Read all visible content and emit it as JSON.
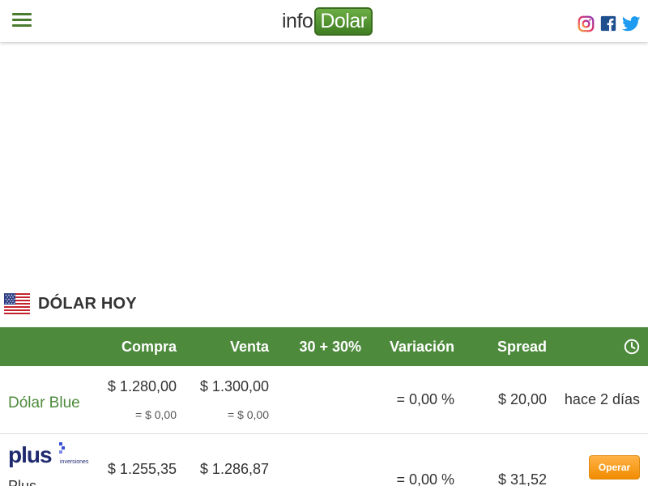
{
  "header": {
    "logo_prefix": "info",
    "logo_box": "Dolar",
    "social": [
      "instagram-icon",
      "facebook-icon",
      "twitter-icon"
    ]
  },
  "section": {
    "title": "DÓLAR HOY",
    "flag": "us-flag-icon"
  },
  "table": {
    "headers": {
      "compra": "Compra",
      "venta": "Venta",
      "tax": "30 + 30%",
      "variacion": "Variación",
      "spread": "Spread",
      "time_icon": "clock-icon"
    },
    "rows": [
      {
        "name": "Dólar Blue",
        "compra": "$ 1.280,00",
        "compra_change": "= $ 0,00",
        "venta": "$ 1.300,00",
        "venta_change": "= $ 0,00",
        "variacion": "= 0,00 %",
        "spread": "$ 20,00",
        "time": "hace 2 días"
      },
      {
        "logo_text": "plus",
        "logo_sub": "inversiones",
        "name": "Plus",
        "compra": "$ 1.255,35",
        "venta": "$ 1.286,87",
        "variacion": "= 0,00 %",
        "spread": "$ 31,52",
        "action_label": "Operar"
      }
    ]
  },
  "colors": {
    "brand_green": "#4d8a3c",
    "header_bg": "#4d8a3c",
    "operar_orange": "#f18c00",
    "plus_navy": "#1f2a6e"
  }
}
